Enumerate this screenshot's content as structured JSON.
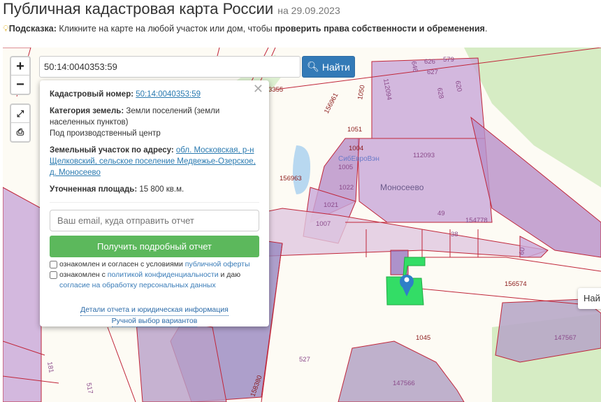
{
  "header": {
    "title": "Публичная кадастровая карта России",
    "date": "на 29.09.2023"
  },
  "hint": {
    "icon": "lightbulb-icon",
    "label": "Подсказка:",
    "text": " Кликните на карте на любой участок или дом, чтобы ",
    "bold": "проверить права собственности и обременения",
    "end": "."
  },
  "map": {
    "zoom_in": "+",
    "zoom_out": "−",
    "search_value": "50:14:0040353:59",
    "find_label": "Найти",
    "right_button": "Най",
    "labels": {
      "l3355": "3355",
      "l156961": "156961",
      "l1050": "1050",
      "l112094": "112094",
      "l646": "646",
      "l626": "626",
      "l627": "627",
      "l628": "628",
      "l579": "579",
      "l620": "620",
      "l1051": "1051",
      "l1004": "1004",
      "l1005": "1005",
      "l112093": "112093",
      "l156963": "156963",
      "l1022": "1022",
      "l1021": "1021",
      "l1007": "1007",
      "l49": "49",
      "l154778": "154778",
      "l38": "38",
      "l60": "60",
      "l156574": "156574",
      "l1045": "1045",
      "l147567": "147567",
      "l147566": "147566",
      "l527": "527",
      "l158380": "158380",
      "l181": "181",
      "l517": "517",
      "place": "Моносеево",
      "company": "СибЕвроВэн"
    },
    "colors": {
      "selected": "#33dd66",
      "parcel": "#c8a8d8",
      "border": "#c0263a",
      "pin": "#2f7fc8"
    }
  },
  "popup": {
    "cad_label": "Кадастровый номер:",
    "cad_value": "50:14:0040353:59",
    "cat_label": "Категория земель:",
    "cat_value": "Земли поселений (земли населенных пунктов)",
    "use": "Под производственный центр",
    "addr_label": "Земельный участок по адресу:",
    "addr_value": "обл. Московская, р-н Щелковский, сельское поселение Медвежье-Озерское, д. Моносеево",
    "area_label": "Уточненная площадь:",
    "area_value": "15 800 кв.м.",
    "email_placeholder": "Ваш email, куда отправить отчет",
    "get_report": "Получить подробный отчет",
    "check1_text": "ознакомлен и согласен с условиями ",
    "check1_link": "публичной оферты",
    "check2_text": "ознакомлен с ",
    "check2_link": "политикой конфиденциальности",
    "check2_mid": " и даю ",
    "check2_link2": "согласие на обработку персональных данных",
    "details_link": "Детали отчета и юридическая информация",
    "manual_link": "Ручной выбор вариантов"
  }
}
